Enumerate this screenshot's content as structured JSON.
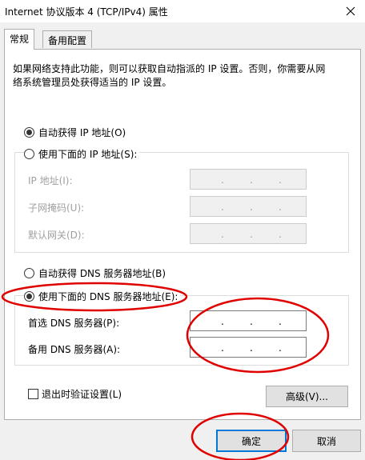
{
  "window": {
    "title": "Internet 协议版本 4 (TCP/IPv4) 属性",
    "close_icon": "close-icon"
  },
  "tabs": [
    {
      "label": "常规",
      "active": true
    },
    {
      "label": "备用配置",
      "active": false
    }
  ],
  "description": "如果网络支持此功能，则可以获取自动指派的 IP 设置。否则，你需要从网络系统管理员处获得适当的 IP 设置。",
  "ip": {
    "auto_label": "自动获得 IP 地址(O)",
    "manual_label": "使用下面的 IP 地址(S):",
    "auto_selected": true,
    "address_label": "IP 地址(I):",
    "subnet_label": "子网掩码(U):",
    "gateway_label": "默认网关(D):"
  },
  "dns": {
    "auto_label": "自动获得 DNS 服务器地址(B)",
    "manual_label": "使用下面的 DNS 服务器地址(E):",
    "manual_selected": true,
    "preferred_label": "首选 DNS 服务器(P):",
    "alternate_label": "备用 DNS 服务器(A):"
  },
  "validate_on_exit_label": "退出时验证设置(L)",
  "advanced_label": "高级(V)...",
  "ok_label": "确定",
  "cancel_label": "取消",
  "annotation_color": "#e00000"
}
